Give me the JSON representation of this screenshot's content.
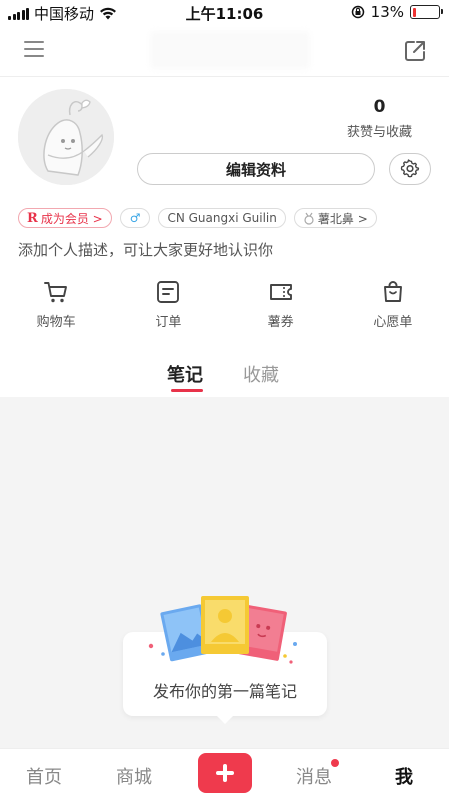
{
  "status_bar": {
    "carrier": "中国移动",
    "time": "上午11:06",
    "battery": "13%",
    "battery_level": 0.13
  },
  "profile": {
    "stats": {
      "count": "0",
      "label": "获赞与收藏"
    },
    "edit_button": "编辑资料",
    "tags": {
      "vip_r": "R",
      "vip": "成为会员 >",
      "gender": "♂",
      "location": "CN Guangxi Guilin",
      "nickname": "薯北鼻 >"
    },
    "description": "添加个人描述，可让大家更好地认识你"
  },
  "quick_actions": [
    {
      "label": "购物车",
      "icon": "cart-icon"
    },
    {
      "label": "订单",
      "icon": "order-icon"
    },
    {
      "label": "薯券",
      "icon": "coupon-icon"
    },
    {
      "label": "心愿单",
      "icon": "wishlist-icon"
    }
  ],
  "tabs": {
    "notes": "笔记",
    "collections": "收藏"
  },
  "empty_state": {
    "text": "发布你的第一篇笔记"
  },
  "bottom_nav": {
    "home": "首页",
    "mall": "商城",
    "messages": "消息",
    "me": "我"
  },
  "colors": {
    "accent": "#ef3a4d",
    "vip": "#e8334a",
    "gender": "#3aa6e6"
  }
}
